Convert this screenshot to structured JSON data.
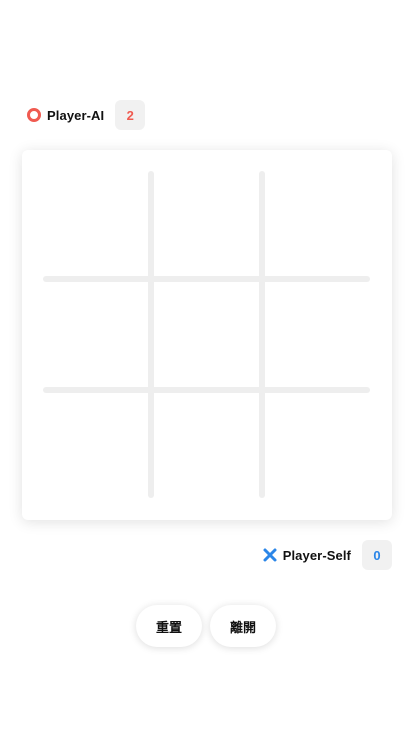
{
  "opponent": {
    "name": "Player-AI",
    "score": "2",
    "mark": "o",
    "icon": "o-ring-icon",
    "color": "#f05a50"
  },
  "self": {
    "name": "Player-Self",
    "score": "0",
    "mark": "x",
    "icon": "x-mark-icon",
    "color": "#2b86e8"
  },
  "board": {
    "cells": [
      "",
      "",
      "",
      "",
      "",
      "",
      "",
      "",
      ""
    ]
  },
  "actions": {
    "reset_label": "重置",
    "leave_label": "離開"
  }
}
